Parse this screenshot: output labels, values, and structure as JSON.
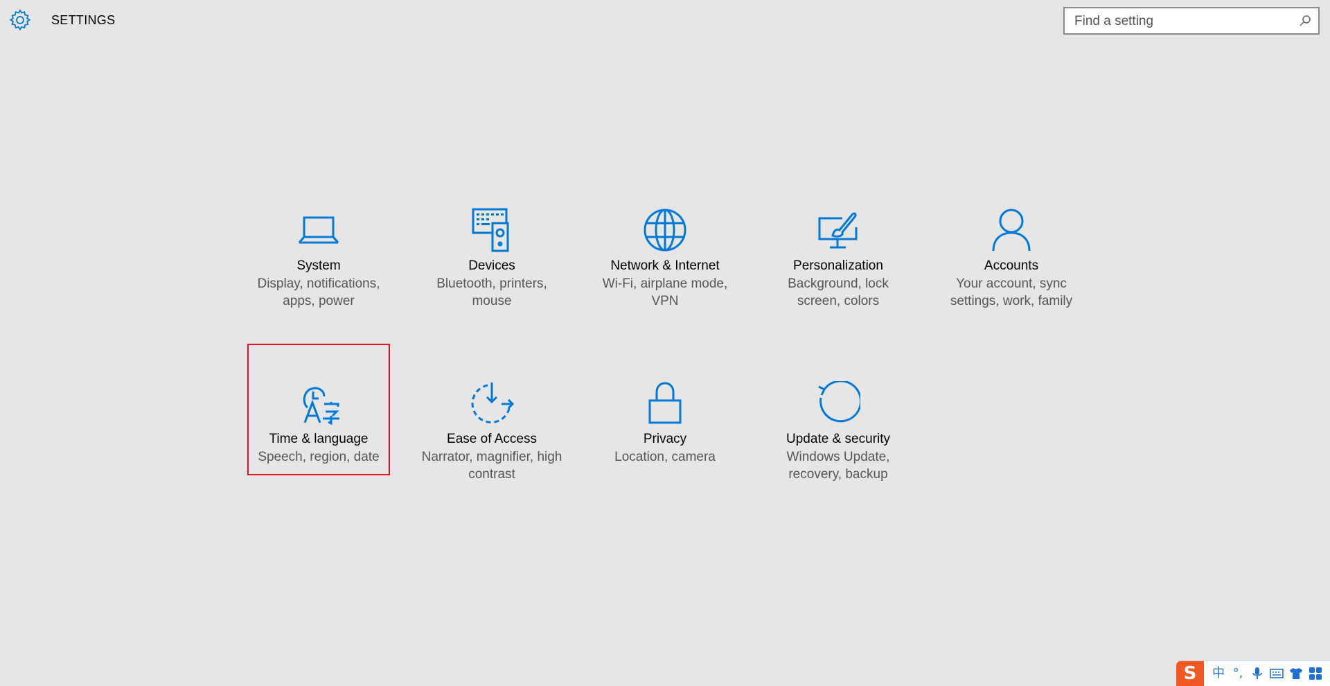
{
  "header": {
    "title": "SETTINGS",
    "search_placeholder": "Find a setting"
  },
  "tiles": [
    {
      "name": "System",
      "desc": "Display, notifications, apps, power",
      "icon": "laptop-icon"
    },
    {
      "name": "Devices",
      "desc": "Bluetooth, printers, mouse",
      "icon": "keyboard-speaker-icon"
    },
    {
      "name": "Network & Internet",
      "desc": "Wi-Fi, airplane mode, VPN",
      "icon": "globe-icon"
    },
    {
      "name": "Personalization",
      "desc": "Background, lock screen, colors",
      "icon": "paint-monitor-icon"
    },
    {
      "name": "Accounts",
      "desc": "Your account, sync settings, work, family",
      "icon": "person-icon"
    },
    {
      "name": "Time & language",
      "desc": "Speech, region, date",
      "icon": "clock-language-icon",
      "selected": true
    },
    {
      "name": "Ease of Access",
      "desc": "Narrator, magnifier, high contrast",
      "icon": "ease-of-access-icon"
    },
    {
      "name": "Privacy",
      "desc": "Location, camera",
      "icon": "lock-icon"
    },
    {
      "name": "Update & security",
      "desc": "Windows Update, recovery, backup",
      "icon": "refresh-icon"
    }
  ],
  "tray": {
    "logo": "S",
    "items": [
      "中",
      "°,",
      "microphone-icon",
      "keyboard-icon",
      "shirt-icon",
      "grid-icon"
    ]
  },
  "colors": {
    "accent": "#0078d7",
    "background": "#e6e6e6",
    "selection": "#e81123"
  }
}
